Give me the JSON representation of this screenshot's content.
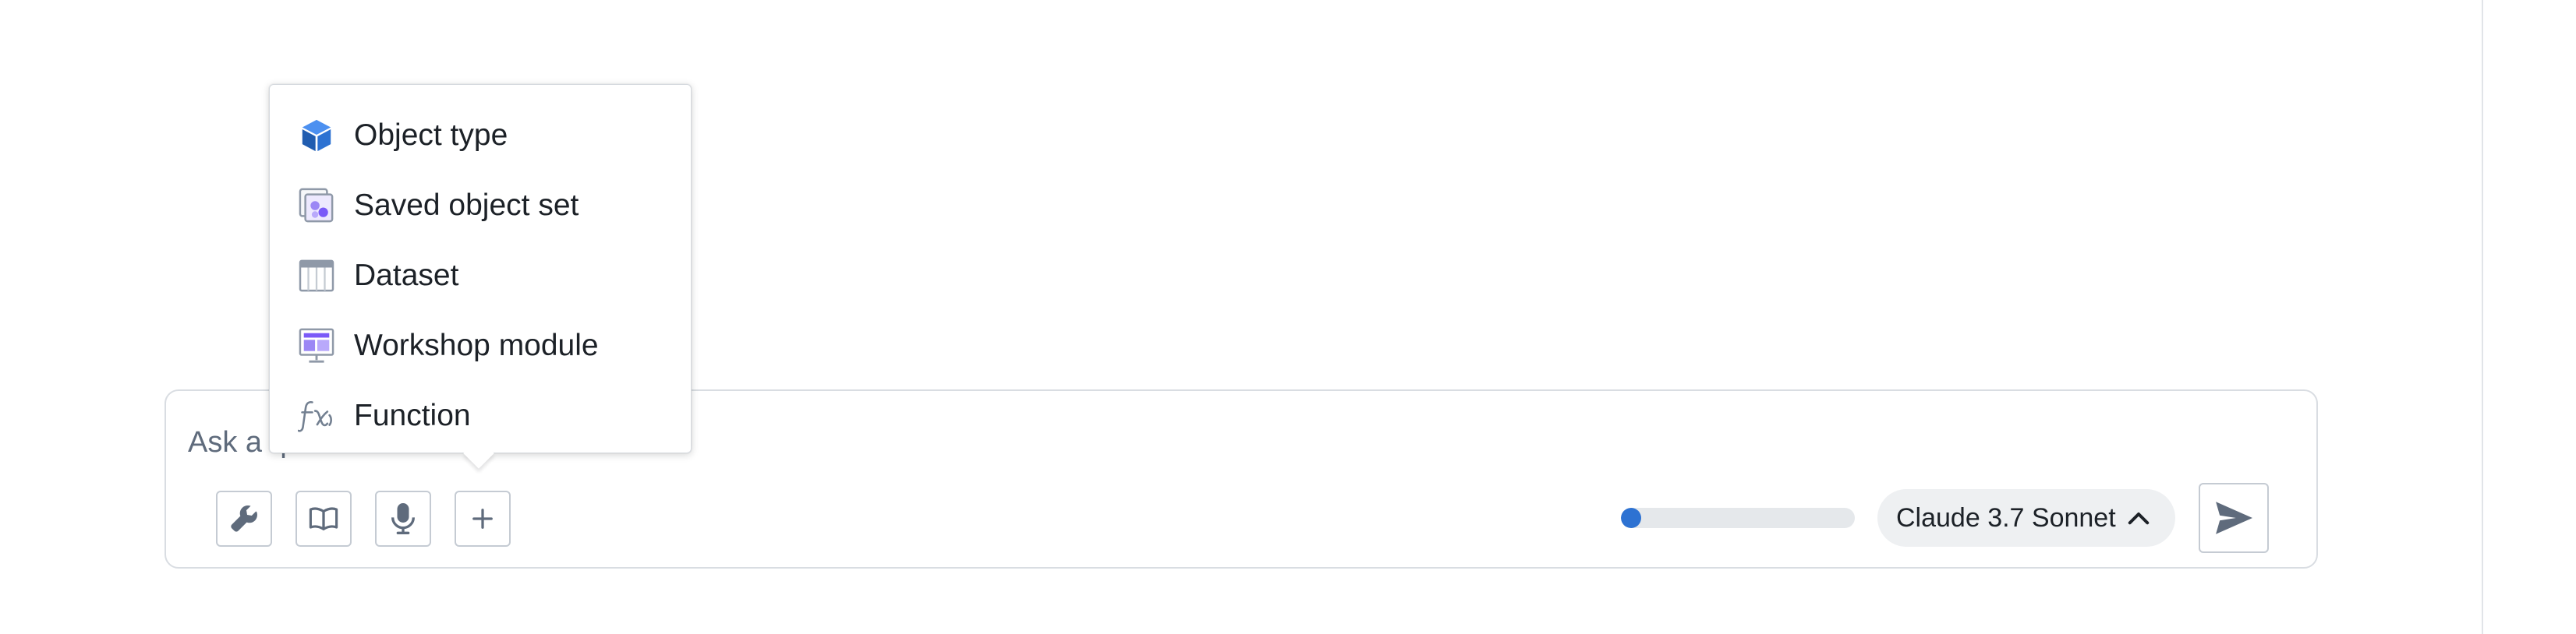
{
  "chat": {
    "placeholder": "Ask a question"
  },
  "toolbar": {
    "tools_icon": "wrench-icon",
    "docs_icon": "book-icon",
    "voice_icon": "microphone-icon",
    "add_icon": "plus-icon"
  },
  "context_usage": {
    "fraction": 0.05,
    "fill_color": "#2d72d2"
  },
  "model_selector": {
    "label": "Claude 3.7 Sonnet",
    "icon": "chevron-up-icon"
  },
  "send": {
    "icon": "send-icon"
  },
  "add_menu": {
    "items": [
      {
        "label": "Object type",
        "icon": "cube-icon"
      },
      {
        "label": "Saved object set",
        "icon": "saved-object-set-icon"
      },
      {
        "label": "Dataset",
        "icon": "dataset-table-icon"
      },
      {
        "label": "Workshop module",
        "icon": "workshop-module-icon"
      },
      {
        "label": "Function",
        "icon": "function-icon"
      }
    ]
  },
  "colors": {
    "accent": "#2d72d2",
    "border": "#d9dde2",
    "muted_text": "#5f6b7c",
    "purple_icon": "#7a5af8"
  }
}
